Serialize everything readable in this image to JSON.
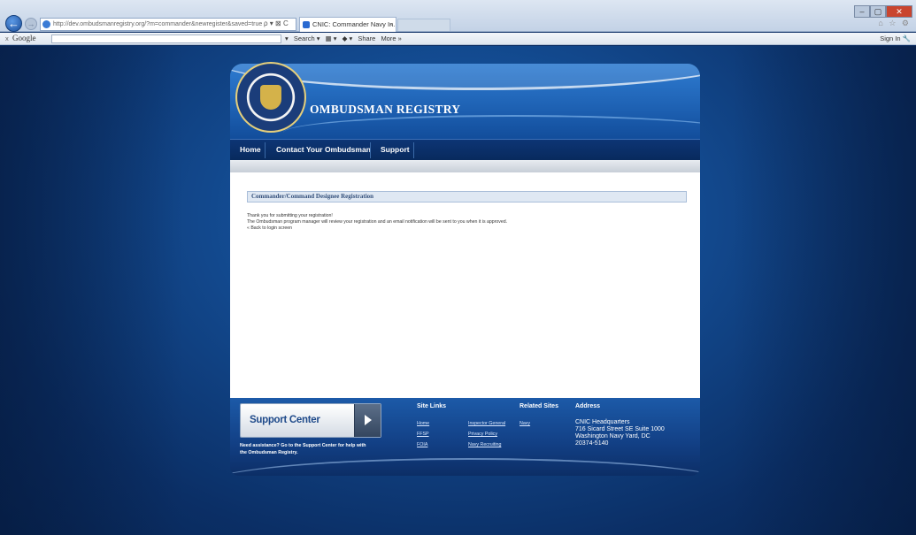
{
  "browser": {
    "url": "http://dev.ombudsmanregistry.org/?m=commander&newregister&saved=true",
    "address_buttons": "ρ ▾ ⊠ C",
    "tab_title": "CNIC: Commander Navy In...",
    "tab_close": "×",
    "back_arrow": "←",
    "forward_arrow": "→",
    "window_minimize": "–",
    "window_maximize": "▢",
    "window_close": "✕",
    "right_icons": "⌂ ☆ ⚙"
  },
  "google_toolbar": {
    "close_x": "x",
    "logo": "Google",
    "search_dropdown": "▾",
    "search_label": "Search ▾",
    "item2": "▦ ▾",
    "item3": "◆ ▾",
    "share_label": "Share",
    "more_label": "More »",
    "signin_label": "Sign In 🔧"
  },
  "site": {
    "title": "OMBUDSMAN REGISTRY",
    "nav": {
      "home": "Home",
      "contact": "Contact Your Ombudsman",
      "support": "Support"
    }
  },
  "content": {
    "section_title": "Commander/Command Designee Registration",
    "line1": "Thank you for submitting your registration!",
    "line2": "The Ombudsman program manager will review your registration and an email notification will be sent to you when it is approved.",
    "back_link": "« Back to login screen"
  },
  "footer": {
    "support_center_label": "Support Center",
    "support_help": "Need assistance? Go to the Support Center for help with the Ombudsman Registry.",
    "site_links_heading": "Site Links",
    "related_sites_heading": "Related Sites",
    "address_heading": "Address",
    "site_links": [
      "Home",
      "FFSP",
      "FOIA"
    ],
    "related_links_col1": [
      "Inspector General",
      "Privacy Policy",
      "Navy Recruiting"
    ],
    "related_links_col2": [
      "Navy"
    ],
    "address_lines": [
      "CNIC Headquarters",
      "716 Sicard Street SE Suite 1000",
      "Washington Navy Yard, DC",
      "20374-5140"
    ]
  }
}
